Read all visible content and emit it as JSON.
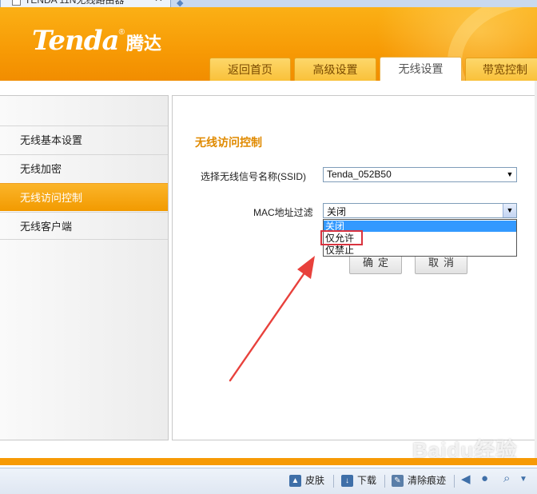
{
  "browser_tab": {
    "title": "TENDA 11N无线路由器",
    "close_glyph": "✕"
  },
  "brand": {
    "logo_word": "Tenda",
    "logo_reg": "®",
    "logo_cn": "腾达"
  },
  "nav": [
    {
      "label": "返回首页"
    },
    {
      "label": "高级设置"
    },
    {
      "label": "无线设置"
    },
    {
      "label": "带宽控制"
    }
  ],
  "sidebar": {
    "items": [
      {
        "label": "无线基本设置"
      },
      {
        "label": "无线加密"
      },
      {
        "label": "无线访问控制"
      },
      {
        "label": "无线客户端"
      }
    ]
  },
  "main": {
    "section_title": "无线访问控制",
    "ssid_label": "选择无线信号名称(SSID)",
    "ssid_value": "Tenda_052B50",
    "mac_label": "MAC地址过滤",
    "mac_value": "关闭",
    "mac_options": [
      "关闭",
      "仅允许",
      "仅禁止"
    ],
    "ok_label": "确定",
    "cancel_label": "取消"
  },
  "statusbar": {
    "skin": "皮肤",
    "download": "下载",
    "clear_trace": "清除痕迹"
  },
  "watermark": "Baidu经验",
  "colors": {
    "accent": "#f79a05",
    "highlight": "#d9333f",
    "selection": "#3399ff"
  }
}
